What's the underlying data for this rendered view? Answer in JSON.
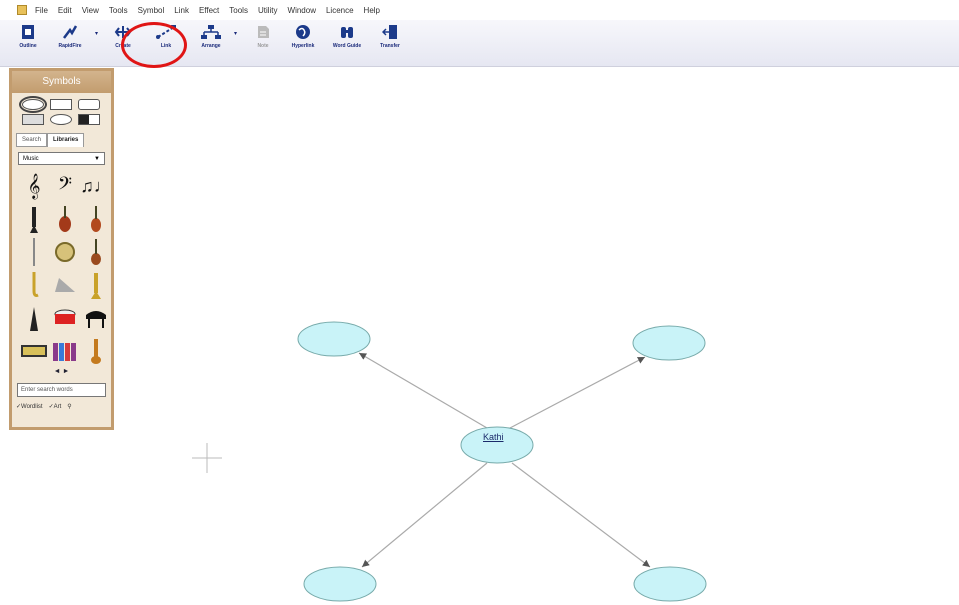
{
  "menu": {
    "items": [
      "File",
      "Edit",
      "View",
      "Tools",
      "Symbol",
      "Link",
      "Effect",
      "Tools",
      "Utility",
      "Window",
      "Licence",
      "Help"
    ]
  },
  "toolbar": {
    "outline_label": "Outline",
    "rapidfire_label": "RapidFire",
    "create_label": "Create",
    "link_label": "Link",
    "arrange_label": "Arrange",
    "note_label": "Note",
    "hyperlink_label": "Hyperlink",
    "wordguide_label": "Word Guide",
    "transfer_label": "Transfer"
  },
  "palette": {
    "title": "Symbols",
    "tab_search": "Search",
    "tab_libraries": "Libraries",
    "library_selected": "Music",
    "nav": "◄ ►",
    "search_placeholder": "Enter search words",
    "check_wordlist": "✓Wordlist",
    "check_art": "✓Art",
    "symbols": [
      "treble-clef",
      "bass-clef",
      "music-notes",
      "clarinet",
      "violin",
      "cello",
      "flute",
      "tambourine",
      "double-bass",
      "saxophone",
      "triangle",
      "trombone",
      "metronome",
      "drum",
      "grand-piano",
      "keyboard",
      "xylophone",
      "trumpet"
    ]
  },
  "diagram": {
    "center_label": "Kathi",
    "node_color": "#c9f3f8"
  },
  "colors": {
    "highlight": "#e01515",
    "palette_border": "#c29c6e"
  }
}
